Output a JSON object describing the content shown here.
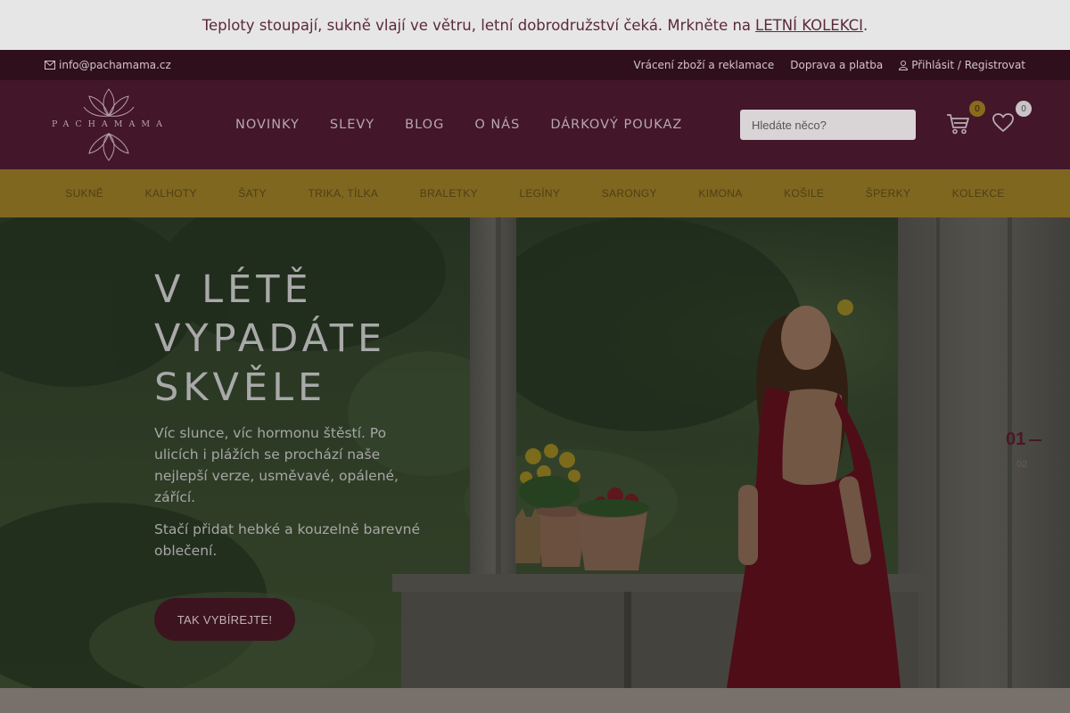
{
  "announcement": {
    "text": "Teploty stoupají, sukně vlají ve větru, letní dobrodružství čeká. Mrkněte na",
    "link": "LETNÍ KOLEKCI",
    "end": "."
  },
  "utility": {
    "email": "info@pachamama.cz",
    "returns": "Vrácení zboží a reklamace",
    "shipping": "Doprava a platba",
    "login": "Přihlásit / Registrovat"
  },
  "header": {
    "logo_text": "PACHAMAMA",
    "nav": [
      "NOVINKY",
      "SLEVY",
      "BLOG",
      "O NÁS",
      "DÁRKOVÝ POUKAZ"
    ],
    "search_placeholder": "Hledáte něco?",
    "cart_count": "0",
    "wishlist_count": "0"
  },
  "categories": [
    "SUKNĚ",
    "KALHOTY",
    "ŠATY",
    "TRIKA, TÍLKA",
    "BRALETKY",
    "LEGÍNY",
    "SARONGY",
    "KIMONA",
    "KOŠILE",
    "ŠPERKY",
    "KOLEKCE"
  ],
  "hero": {
    "title_line1": "V LÉTĚ",
    "title_line2": "VYPADÁTE",
    "title_line3": "SKVĚLE",
    "paragraph1": "Víc slunce, víc hormonu štěstí. Po ulicích i plážích se prochází naše nejlepší verze, usměvavé, opálené, zářící.",
    "paragraph2": "Stačí přidat hebké a kouzelně barevné oblečení.",
    "cta": "TAK VYBÍREJTE!",
    "slide_current": "01",
    "slide_next": "02"
  },
  "colors": {
    "announcement_bg": "#e7e6e6",
    "utility_bg": "#2f0f1c",
    "header_bg": "#43162a",
    "category_bg": "#7f6720",
    "cta_bg": "#3e1320"
  },
  "icons": [
    "envelope-icon",
    "user-icon",
    "cart-icon",
    "heart-icon",
    "lotus-logo"
  ]
}
